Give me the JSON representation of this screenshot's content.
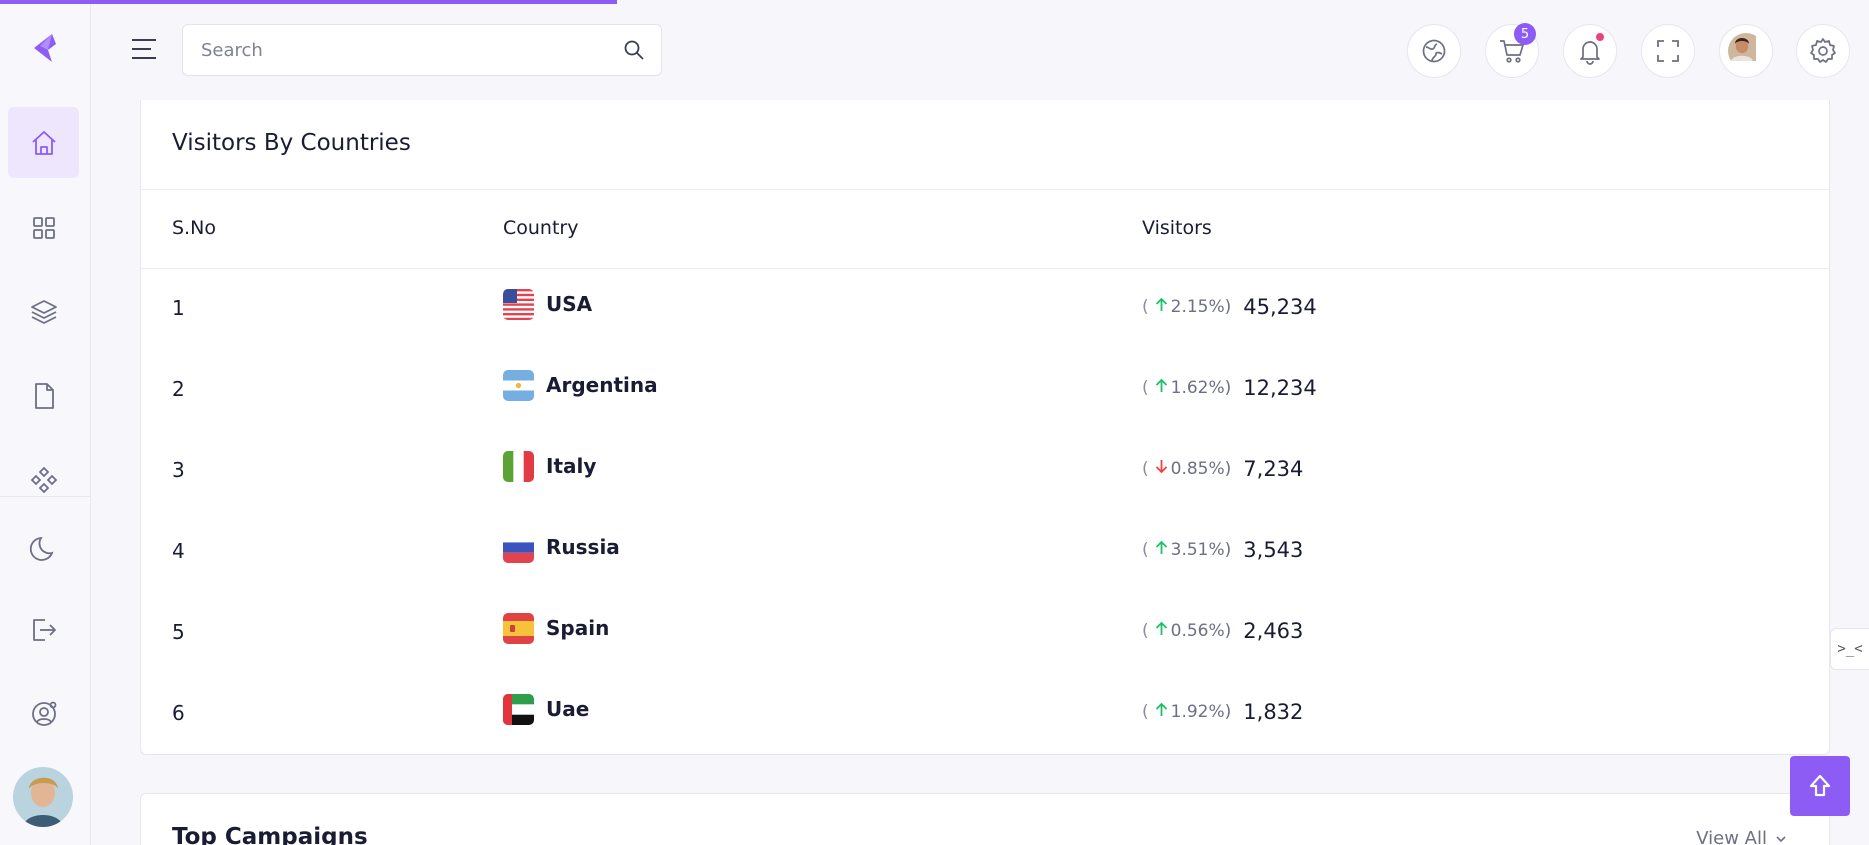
{
  "page_load_progress_percent": 33,
  "brand": {
    "logo_icon": "brand-logo-icon",
    "accent_color": "#8c5cf5"
  },
  "sidebar": {
    "items": [
      {
        "icon": "home-icon",
        "active": true
      },
      {
        "icon": "grid-icon",
        "active": false
      },
      {
        "icon": "layers-icon",
        "active": false
      },
      {
        "icon": "file-icon",
        "active": false
      },
      {
        "icon": "components-icon",
        "active": false
      },
      {
        "icon": "moon-icon",
        "active": false
      },
      {
        "icon": "logout-icon",
        "active": false
      },
      {
        "icon": "user-settings-icon",
        "active": false
      }
    ],
    "avatar_icon": "user-avatar"
  },
  "header": {
    "menu_icon": "hamburger-menu-icon",
    "search": {
      "placeholder": "Search",
      "value": ""
    },
    "cart_badge": "5",
    "icons": [
      "globe-icon",
      "cart-icon",
      "bell-icon",
      "fullscreen-icon",
      "profile-avatar",
      "gear-icon"
    ]
  },
  "visitors_card": {
    "title": "Visitors By Countries",
    "columns": [
      "S.No",
      "Country",
      "Visitors"
    ],
    "rows": [
      {
        "sno": "1",
        "country": "USA",
        "flag": "us",
        "trend": "up",
        "change": "2.15%)",
        "visitors": "45,234"
      },
      {
        "sno": "2",
        "country": "Argentina",
        "flag": "ar",
        "trend": "up",
        "change": "1.62%)",
        "visitors": "12,234"
      },
      {
        "sno": "3",
        "country": "Italy",
        "flag": "it",
        "trend": "down",
        "change": "0.85%)",
        "visitors": "7,234"
      },
      {
        "sno": "4",
        "country": "Russia",
        "flag": "ru",
        "trend": "up",
        "change": "3.51%)",
        "visitors": "3,543"
      },
      {
        "sno": "5",
        "country": "Spain",
        "flag": "es",
        "trend": "up",
        "change": "0.56%)",
        "visitors": "2,463"
      },
      {
        "sno": "6",
        "country": "Uae",
        "flag": "ae",
        "trend": "up",
        "change": "1.92%)",
        "visitors": "1,832"
      }
    ]
  },
  "campaigns_card": {
    "title": "Top Campaigns",
    "view_all": "View All"
  },
  "colors": {
    "up": "#1fbf6a",
    "down": "#f0403c"
  }
}
